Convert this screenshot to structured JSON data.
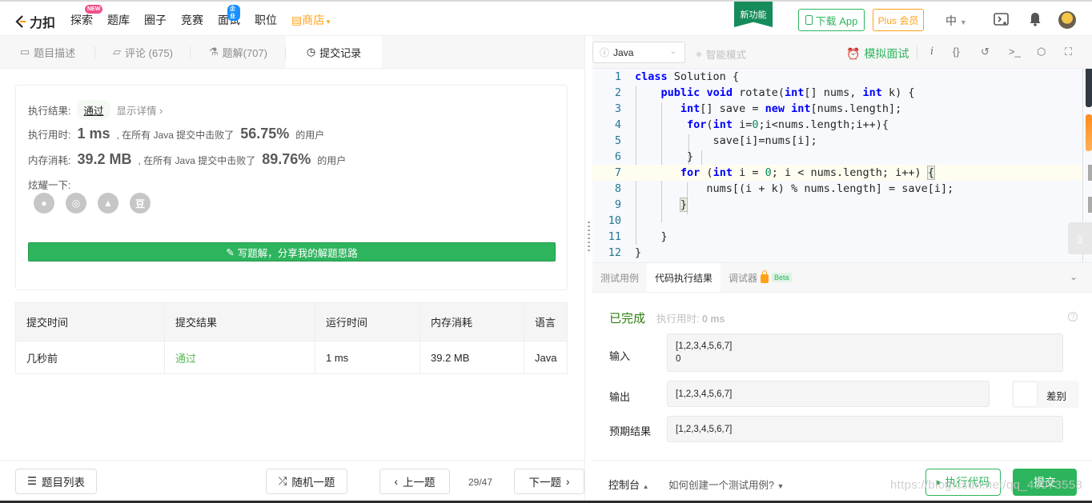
{
  "topbar": {
    "brand": "力扣",
    "nav": [
      {
        "label": "探索",
        "badge": "NEW",
        "badge_color": "#f0508c"
      },
      {
        "label": "题库"
      },
      {
        "label": "圈子"
      },
      {
        "label": "竞赛"
      },
      {
        "label": "面试",
        "badge": "企业",
        "badge_color": "#1a90ff"
      },
      {
        "label": "职位"
      },
      {
        "label": "商店",
        "accent": "#ffa116"
      }
    ],
    "new_feature": "新功能",
    "download_app": "下载 App",
    "plus": "Plus 会员",
    "language": "中"
  },
  "left": {
    "tabs": [
      {
        "label": "题目描述",
        "icon": "description-icon"
      },
      {
        "label": "评论 (675)",
        "icon": "comment-icon"
      },
      {
        "label": "题解(707)",
        "icon": "flask-icon"
      },
      {
        "label": "提交记录",
        "icon": "clock-icon",
        "active": true
      }
    ],
    "result": {
      "exec_label": "执行结果:",
      "status": "通过",
      "show_detail": "显示详情 ›",
      "time_label": "执行用时:",
      "time_value": "1 ms",
      "time_desc": ", 在所有 Java 提交中击败了",
      "time_pct": "56.75%",
      "users": "的用户",
      "mem_label": "内存消耗:",
      "mem_value": "39.2 MB",
      "mem_desc": ", 在所有 Java 提交中击败了",
      "mem_pct": "89.76%",
      "share_label": "炫耀一下:",
      "share_icons": [
        "wechat-icon",
        "weibo-icon",
        "qq-icon",
        "douban-icon"
      ],
      "douban_glyph": "豆",
      "write_solution": "写题解，分享我的解题思路"
    },
    "table": {
      "headers": [
        "提交时间",
        "提交结果",
        "运行时间",
        "内存消耗",
        "语言"
      ],
      "rows": [
        [
          "几秒前",
          "通过",
          "1 ms",
          "39.2 MB",
          "Java"
        ]
      ]
    },
    "footer": {
      "problem_list": "题目列表",
      "random": "随机一题",
      "prev": "上一题",
      "page": "29/47",
      "next": "下一题"
    }
  },
  "editor": {
    "language": "Java",
    "smart_mode": "智能模式",
    "mock_interview": "模拟面试",
    "tools": [
      "info-icon",
      "braces-icon",
      "reset-icon",
      "terminal-icon",
      "settings-icon",
      "fullscreen-icon"
    ],
    "lines": [
      "class Solution {",
      "    public void rotate(int[] nums, int k) {",
      "       int[] save = new int[nums.length];",
      "        for(int i=0;i<nums.length;i++){",
      "            save[i]=nums[i];",
      "        }",
      "       for (int i = 0; i < nums.length; i++) {",
      "           nums[(i + k) % nums.length] = save[i];",
      "       }",
      "",
      "    }",
      "}"
    ],
    "highlight_line": 7
  },
  "console": {
    "tabs": [
      "测试用例",
      "代码执行结果",
      "调试器"
    ],
    "active_tab": 1,
    "beta": "Beta",
    "status": "已完成",
    "exec_time_label": "执行用时:",
    "exec_time": "0 ms",
    "input_label": "输入",
    "input_value": "[1,2,3,4,5,6,7]\n0",
    "output_label": "输出",
    "output_value": "[1,2,3,4,5,6,7]",
    "diff_label": "差别",
    "expected_label": "预期结果",
    "expected_value": "[1,2,3,4,5,6,7]"
  },
  "right_footer": {
    "console": "控制台",
    "howto": "如何创建一个测试用例?",
    "run": "执行代码",
    "submit": "提交"
  },
  "watermark": "https://blog.csdn.net/qq_43073558"
}
